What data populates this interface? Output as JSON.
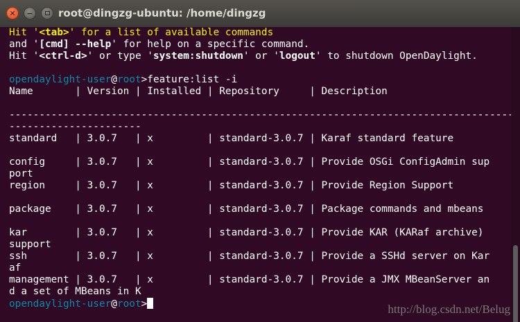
{
  "window": {
    "title": "root@dingzg-ubuntu: /home/dingzg",
    "close_glyph": "✕",
    "min_glyph": "−"
  },
  "terminal": {
    "hint1": {
      "a": "Hit '",
      "b": "<tab>",
      "c": "' for a list of available commands"
    },
    "hint2": {
      "a": "and '",
      "b": "[cmd] --help",
      "c": "' for help on a specific command."
    },
    "hint3": {
      "a": "Hit '",
      "b": "<ctrl-d>",
      "c": "' or type '",
      "d": "system:shutdown",
      "e": "' or '",
      "f": "logout",
      "g": "' to shutdown OpenDaylight."
    },
    "prompt": {
      "user": "opendaylight-user",
      "at": "@",
      "host": "root",
      "sym": ">"
    },
    "command": "feature:list -i",
    "lines": [
      "Name       | Version | Installed | Repository     | Description",
      "",
      "------------------------------------------------------------------------------------------",
      "----------------------",
      "standard   | 3.0.7   | x         | standard-3.0.7 | Karaf standard feature",
      "",
      "config     | 3.0.7   | x         | standard-3.0.7 | Provide OSGi ConfigAdmin sup",
      "port",
      "region     | 3.0.7   | x         | standard-3.0.7 | Provide Region Support",
      "",
      "package    | 3.0.7   | x         | standard-3.0.7 | Package commands and mbeans",
      "",
      "kar        | 3.0.7   | x         | standard-3.0.7 | Provide KAR (KARaf archive)",
      "support",
      "ssh        | 3.0.7   | x         | standard-3.0.7 | Provide a SSHd server on Kar",
      "af",
      "management | 3.0.7   | x         | standard-3.0.7 | Provide a JMX MBeanServer an",
      "d a set of MBeans in K"
    ]
  },
  "watermark": "http://blog.csdn.net/Belug"
}
